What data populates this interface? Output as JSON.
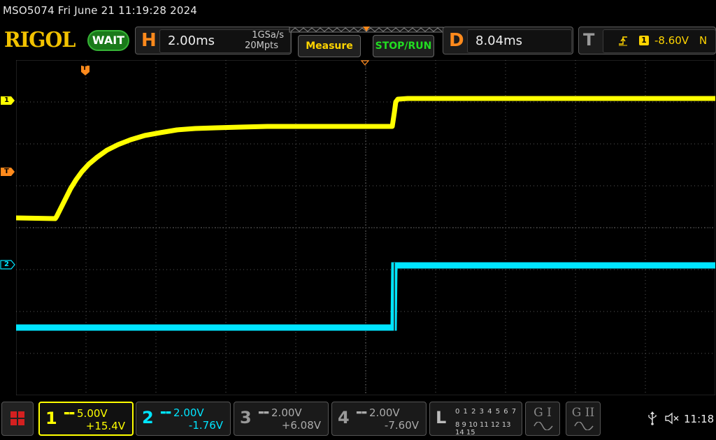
{
  "titlebar": {
    "text": "MSO5074  Fri June 21 11:19:28 2024"
  },
  "brand": {
    "logo": "RIGOL",
    "run_state": "WAIT"
  },
  "horizontal": {
    "letter": "H",
    "timebase": "2.00ms",
    "sample_rate": "1GSa/s",
    "memory_depth": "20Mpts"
  },
  "buttons": {
    "measure": "Measure",
    "stop_run": "STOP/RUN"
  },
  "delay": {
    "letter": "D",
    "value": "8.04ms"
  },
  "trigger": {
    "letter": "T",
    "edge_icon": "rising-edge-icon",
    "source_channel": "1",
    "level": "-8.60V",
    "mode": "N"
  },
  "markers": {
    "ch1": "1",
    "ch2": "2",
    "trig": "T"
  },
  "channels": [
    {
      "num": "1",
      "scale": "5.00V",
      "offset": "+15.4V",
      "color": "#ffff00",
      "active": true
    },
    {
      "num": "2",
      "scale": "2.00V",
      "offset": "-1.76V",
      "color": "#00e5ff",
      "active": true
    },
    {
      "num": "3",
      "scale": "2.00V",
      "offset": "+6.08V",
      "color": "#999999",
      "active": false
    },
    {
      "num": "4",
      "scale": "2.00V",
      "offset": "-7.60V",
      "color": "#999999",
      "active": false
    }
  ],
  "logic": {
    "letter": "L",
    "row1": "0 1 2 3   4 5 6 7",
    "row2": "8 9 10 11 12 13 14 15"
  },
  "generators": {
    "g1": "G I",
    "g2": "G II"
  },
  "status": {
    "time": "11:18",
    "usb_icon": "usb-icon",
    "speaker_icon": "speaker-muted-icon"
  },
  "colors": {
    "ch1": "#ffff00",
    "ch2": "#00e5ff",
    "trigger": "#ff8a1c"
  }
}
